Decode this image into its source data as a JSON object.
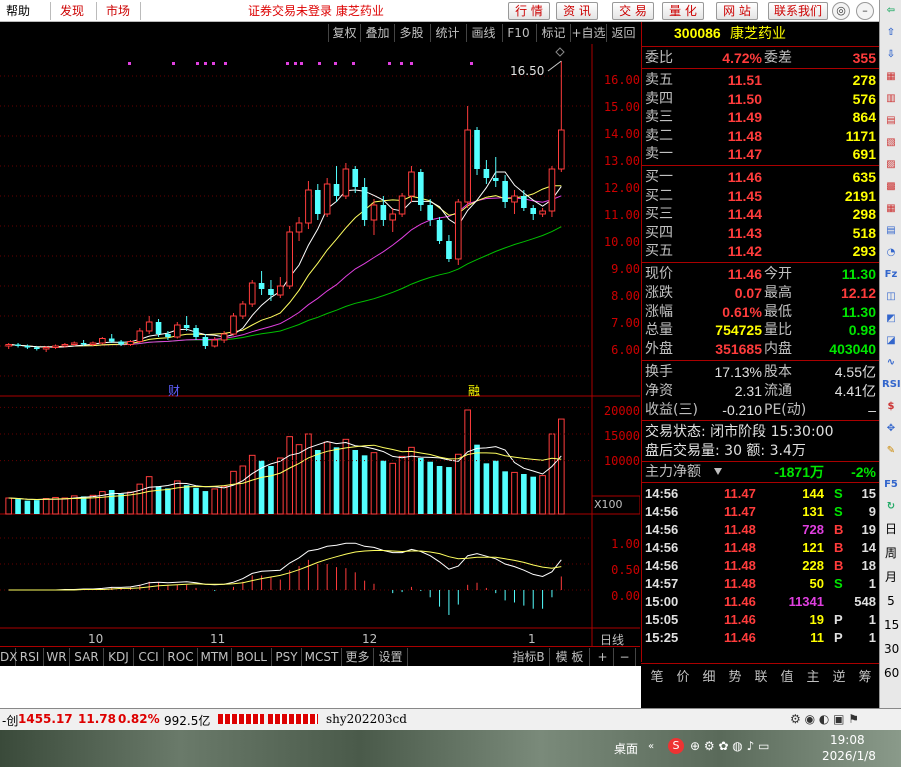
{
  "menu": {
    "help": "帮助",
    "discover": "发现",
    "market": "市场"
  },
  "status_title": "证券交易未登录  康芝药业",
  "top_buttons": [
    "行 情",
    "资 讯",
    "交 易",
    "量 化",
    "网 站",
    "联系我们"
  ],
  "window_controls": [
    "◎",
    "–",
    "□",
    "✕"
  ],
  "chart_toolbar": [
    "复权",
    "叠加",
    "多股",
    "统计",
    "画线",
    "F10",
    "标记",
    "+自选",
    "返回"
  ],
  "chart_labels": {
    "high_marker": "16.50",
    "caibao": "财",
    "rongquan": "融",
    "period": "日线",
    "vol_unit": "X100"
  },
  "price_axis": [
    "16.00",
    "15.00",
    "14.00",
    "13.00",
    "12.00",
    "11.00",
    "10.00",
    "9.00",
    "8.00",
    "7.00",
    "6.00"
  ],
  "vol_axis": [
    "20000",
    "15000",
    "10000"
  ],
  "macd_axis": [
    "1.00",
    "0.50",
    "0.00"
  ],
  "date_axis": [
    "10",
    "11",
    "12",
    "1"
  ],
  "indicators": [
    "DX",
    "RSI",
    "WR",
    "SAR",
    "KDJ",
    "CCI",
    "ROC",
    "MTM",
    "BOLL",
    "PSY",
    "MCST",
    "更多",
    "设置"
  ],
  "indicator_right": [
    "指标B",
    "模 板",
    "+",
    "−"
  ],
  "stock": {
    "code": "300086",
    "name": "康芝药业"
  },
  "webi": {
    "label_a": "委比",
    "value_a": "4.72%",
    "label_b": "委差",
    "value_b": "355"
  },
  "asks": [
    {
      "label": "卖五",
      "price": "11.51",
      "vol": "278"
    },
    {
      "label": "卖四",
      "price": "11.50",
      "vol": "576"
    },
    {
      "label": "卖三",
      "price": "11.49",
      "vol": "864"
    },
    {
      "label": "卖二",
      "price": "11.48",
      "vol": "1171"
    },
    {
      "label": "卖一",
      "price": "11.47",
      "vol": "691"
    }
  ],
  "bids": [
    {
      "label": "买一",
      "price": "11.46",
      "vol": "635"
    },
    {
      "label": "买二",
      "price": "11.45",
      "vol": "2191"
    },
    {
      "label": "买三",
      "price": "11.44",
      "vol": "298"
    },
    {
      "label": "买四",
      "price": "11.43",
      "vol": "518"
    },
    {
      "label": "买五",
      "price": "11.42",
      "vol": "293"
    }
  ],
  "stats": [
    {
      "l1": "现价",
      "v1": "11.46",
      "l2": "今开",
      "v2": "11.30"
    },
    {
      "l1": "涨跌",
      "v1": "0.07",
      "l2": "最高",
      "v2": "12.12"
    },
    {
      "l1": "涨幅",
      "v1": "0.61%",
      "l2": "最低",
      "v2": "11.30"
    },
    {
      "l1": "总量",
      "v1": "754725",
      "l2": "量比",
      "v2": "0.98"
    },
    {
      "l1": "外盘",
      "v1": "351685",
      "l2": "内盘",
      "v2": "403040"
    }
  ],
  "stats2": [
    {
      "l1": "换手",
      "v1": "17.13%",
      "l2": "股本",
      "v2": "4.55亿"
    },
    {
      "l1": "净资",
      "v1": "2.31",
      "l2": "流通",
      "v2": "4.41亿"
    },
    {
      "l1": "收益(三)",
      "v1": "-0.210",
      "l2": "PE(动)",
      "v2": "–"
    }
  ],
  "trade_status": "交易状态: 闭市阶段 15:30:00",
  "after_hours": "盘后交易量: 30  额: 3.4万",
  "main_flow": {
    "label": "主力净额",
    "value": "-1871万",
    "pct": "-2%"
  },
  "ticks": [
    {
      "t": "14:56",
      "p": "11.47",
      "v": "144",
      "s": "S",
      "n": "15"
    },
    {
      "t": "14:56",
      "p": "11.47",
      "v": "131",
      "s": "S",
      "n": "9"
    },
    {
      "t": "14:56",
      "p": "11.48",
      "v": "728",
      "s": "B",
      "n": "19"
    },
    {
      "t": "14:56",
      "p": "11.48",
      "v": "121",
      "s": "B",
      "n": "14"
    },
    {
      "t": "14:56",
      "p": "11.48",
      "v": "228",
      "s": "B",
      "n": "18"
    },
    {
      "t": "14:57",
      "p": "11.48",
      "v": "50",
      "s": "S",
      "n": "1"
    },
    {
      "t": "15:00",
      "p": "11.46",
      "v": "11341",
      "s": "",
      "n": "548"
    },
    {
      "t": "15:05",
      "p": "11.46",
      "v": "19",
      "s": "P",
      "n": "1"
    },
    {
      "t": "15:25",
      "p": "11.46",
      "v": "11",
      "s": "P",
      "n": "1"
    }
  ],
  "quote_tabs": [
    "笔",
    "价",
    "细",
    "势",
    "联",
    "值",
    "主",
    "逆",
    "筹"
  ],
  "right_tools": [
    "日",
    "周",
    "月",
    "5",
    "15",
    "30",
    "60"
  ],
  "bottom": {
    "index_name": "-创",
    "index_value": "1455.17",
    "index_chg": "11.78",
    "index_pct": "0.82%",
    "turnover": "992.5亿",
    "user": "shy202203cd"
  },
  "taskbar": {
    "desktop": "桌面",
    "time": "19:08",
    "date": "2026/1/8"
  },
  "chart_data": {
    "type": "candlestick",
    "ylim": [
      6.0,
      16.8
    ],
    "candles": [
      [
        7.0,
        7.1,
        6.9,
        7.05
      ],
      [
        7.05,
        7.1,
        6.95,
        7.0
      ],
      [
        7.0,
        7.05,
        6.9,
        6.95
      ],
      [
        6.95,
        7.0,
        6.85,
        6.9
      ],
      [
        6.9,
        7.0,
        6.8,
        6.95
      ],
      [
        6.95,
        7.05,
        6.9,
        7.0
      ],
      [
        7.0,
        7.1,
        6.95,
        7.05
      ],
      [
        7.05,
        7.15,
        7.0,
        7.1
      ],
      [
        7.1,
        7.2,
        7.0,
        7.05
      ],
      [
        7.05,
        7.15,
        7.0,
        7.1
      ],
      [
        7.1,
        7.3,
        7.05,
        7.25
      ],
      [
        7.25,
        7.4,
        7.1,
        7.15
      ],
      [
        7.15,
        7.2,
        7.0,
        7.05
      ],
      [
        7.05,
        7.2,
        7.0,
        7.15
      ],
      [
        7.15,
        7.6,
        7.1,
        7.5
      ],
      [
        7.5,
        8.0,
        7.4,
        7.8
      ],
      [
        7.8,
        7.9,
        7.3,
        7.4
      ],
      [
        7.4,
        7.5,
        7.2,
        7.3
      ],
      [
        7.3,
        7.8,
        7.25,
        7.7
      ],
      [
        7.7,
        8.0,
        7.5,
        7.6
      ],
      [
        7.6,
        7.7,
        7.2,
        7.3
      ],
      [
        7.3,
        7.4,
        6.9,
        7.0
      ],
      [
        7.0,
        7.3,
        6.95,
        7.2
      ],
      [
        7.2,
        7.5,
        7.1,
        7.4
      ],
      [
        7.4,
        8.1,
        7.35,
        8.0
      ],
      [
        8.0,
        8.5,
        7.9,
        8.4
      ],
      [
        8.4,
        9.2,
        8.3,
        9.1
      ],
      [
        9.1,
        9.5,
        8.7,
        8.9
      ],
      [
        8.9,
        9.2,
        8.5,
        8.7
      ],
      [
        8.7,
        9.3,
        8.6,
        9.0
      ],
      [
        9.0,
        11.0,
        8.9,
        10.8
      ],
      [
        10.8,
        11.3,
        10.5,
        11.1
      ],
      [
        11.1,
        12.5,
        10.9,
        12.2
      ],
      [
        12.2,
        12.4,
        11.2,
        11.4
      ],
      [
        11.4,
        12.6,
        11.3,
        12.4
      ],
      [
        12.4,
        13.0,
        11.8,
        12.0
      ],
      [
        12.0,
        13.1,
        11.9,
        12.9
      ],
      [
        12.9,
        13.0,
        12.1,
        12.3
      ],
      [
        12.3,
        12.6,
        11.0,
        11.2
      ],
      [
        11.2,
        11.9,
        10.7,
        11.7
      ],
      [
        11.7,
        12.0,
        11.0,
        11.2
      ],
      [
        11.2,
        11.6,
        10.8,
        11.4
      ],
      [
        11.4,
        12.1,
        11.3,
        12.0
      ],
      [
        12.0,
        13.0,
        11.8,
        12.8
      ],
      [
        12.8,
        12.9,
        11.5,
        11.7
      ],
      [
        11.7,
        11.9,
        11.0,
        11.2
      ],
      [
        11.2,
        11.3,
        10.4,
        10.5
      ],
      [
        10.5,
        10.7,
        9.8,
        9.9
      ],
      [
        9.9,
        11.9,
        9.7,
        11.8
      ],
      [
        11.8,
        15.0,
        11.6,
        14.2
      ],
      [
        14.2,
        14.3,
        12.7,
        12.9
      ],
      [
        12.9,
        13.2,
        12.4,
        12.6
      ],
      [
        12.6,
        13.3,
        12.3,
        12.5
      ],
      [
        12.5,
        12.7,
        11.6,
        11.8
      ],
      [
        11.8,
        12.2,
        11.4,
        12.0
      ],
      [
        12.0,
        12.2,
        11.5,
        11.6
      ],
      [
        11.6,
        11.7,
        11.2,
        11.4
      ],
      [
        11.4,
        11.6,
        11.3,
        11.5
      ],
      [
        11.5,
        13.0,
        11.3,
        12.9
      ],
      [
        12.9,
        16.5,
        12.8,
        14.2
      ]
    ],
    "volumes": [
      3000,
      2800,
      2500,
      2600,
      2900,
      3100,
      3000,
      3400,
      3300,
      3500,
      4200,
      4500,
      3800,
      4100,
      5600,
      7000,
      5200,
      4800,
      6200,
      5400,
      4900,
      4300,
      4700,
      5200,
      8000,
      9000,
      11000,
      10000,
      9000,
      10500,
      14500,
      13000,
      15000,
      12000,
      13500,
      12500,
      14000,
      12000,
      11000,
      11500,
      10000,
      9500,
      10800,
      12500,
      10500,
      9800,
      9000,
      8800,
      11200,
      19500,
      13000,
      9500,
      10000,
      8000,
      7800,
      7500,
      7000,
      7200,
      15000,
      17800
    ],
    "macd_diff": [
      0,
      0,
      0,
      0,
      0,
      0,
      0.01,
      0.01,
      0.02,
      0.02,
      0.03,
      0.05,
      0.05,
      0.06,
      0.09,
      0.14,
      0.15,
      0.14,
      0.15,
      0.16,
      0.14,
      0.11,
      0.1,
      0.11,
      0.15,
      0.22,
      0.32,
      0.36,
      0.37,
      0.38,
      0.52,
      0.62,
      0.75,
      0.78,
      0.84,
      0.86,
      0.9,
      0.9,
      0.84,
      0.82,
      0.76,
      0.72,
      0.72,
      0.78,
      0.74,
      0.66,
      0.54,
      0.4,
      0.46,
      0.66,
      0.7,
      0.65,
      0.6,
      0.5,
      0.45,
      0.38,
      0.3,
      0.26,
      0.35,
      0.58
    ],
    "macd_dea": [
      0,
      0,
      0,
      0,
      0,
      0,
      0,
      0,
      0.01,
      0.01,
      0.01,
      0.02,
      0.03,
      0.03,
      0.04,
      0.06,
      0.08,
      0.09,
      0.1,
      0.11,
      0.12,
      0.11,
      0.11,
      0.11,
      0.12,
      0.14,
      0.18,
      0.22,
      0.25,
      0.28,
      0.33,
      0.39,
      0.46,
      0.53,
      0.59,
      0.64,
      0.69,
      0.73,
      0.75,
      0.76,
      0.76,
      0.75,
      0.74,
      0.75,
      0.75,
      0.73,
      0.7,
      0.64,
      0.6,
      0.61,
      0.63,
      0.63,
      0.63,
      0.6,
      0.57,
      0.53,
      0.48,
      0.44,
      0.42,
      0.45
    ]
  }
}
